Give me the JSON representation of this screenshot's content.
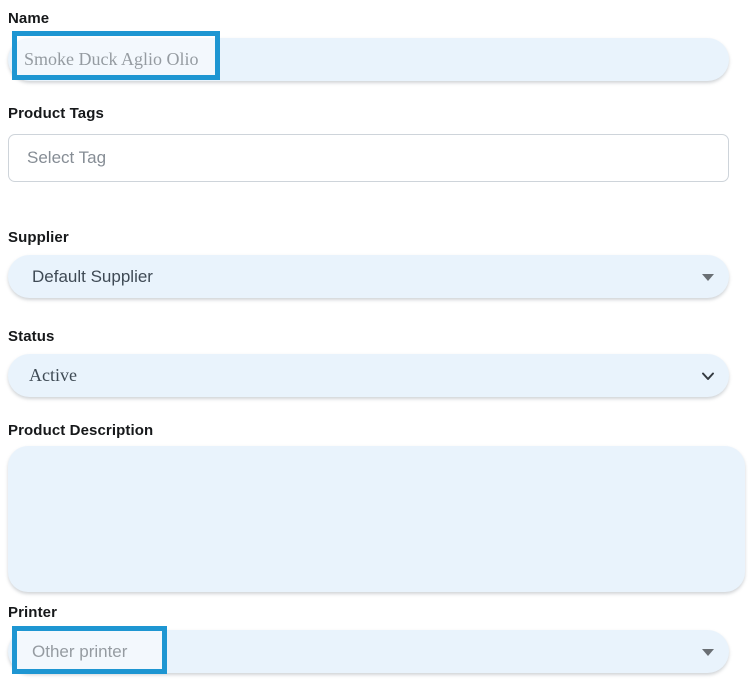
{
  "form": {
    "fields": {
      "name": {
        "label": "Name",
        "value": "Smoke Duck Aglio Olio"
      },
      "product_tags": {
        "label": "Product Tags",
        "placeholder": "Select Tag",
        "value": ""
      },
      "supplier": {
        "label": "Supplier",
        "value": "Default Supplier"
      },
      "status": {
        "label": "Status",
        "value": "Active"
      },
      "product_description": {
        "label": "Product Description",
        "value": ""
      },
      "printer": {
        "label": "Printer",
        "value": "Other printer"
      }
    },
    "annotations": {
      "highlighted_fields": [
        "name",
        "printer"
      ]
    },
    "colors": {
      "highlight_border": "#1e96d2",
      "filled_field_bg": "#e9f3fc",
      "outlined_field_border": "#ced4da",
      "label_text": "#16181a",
      "value_text": "#3f4a55",
      "placeholder_text": "#868d95"
    }
  }
}
